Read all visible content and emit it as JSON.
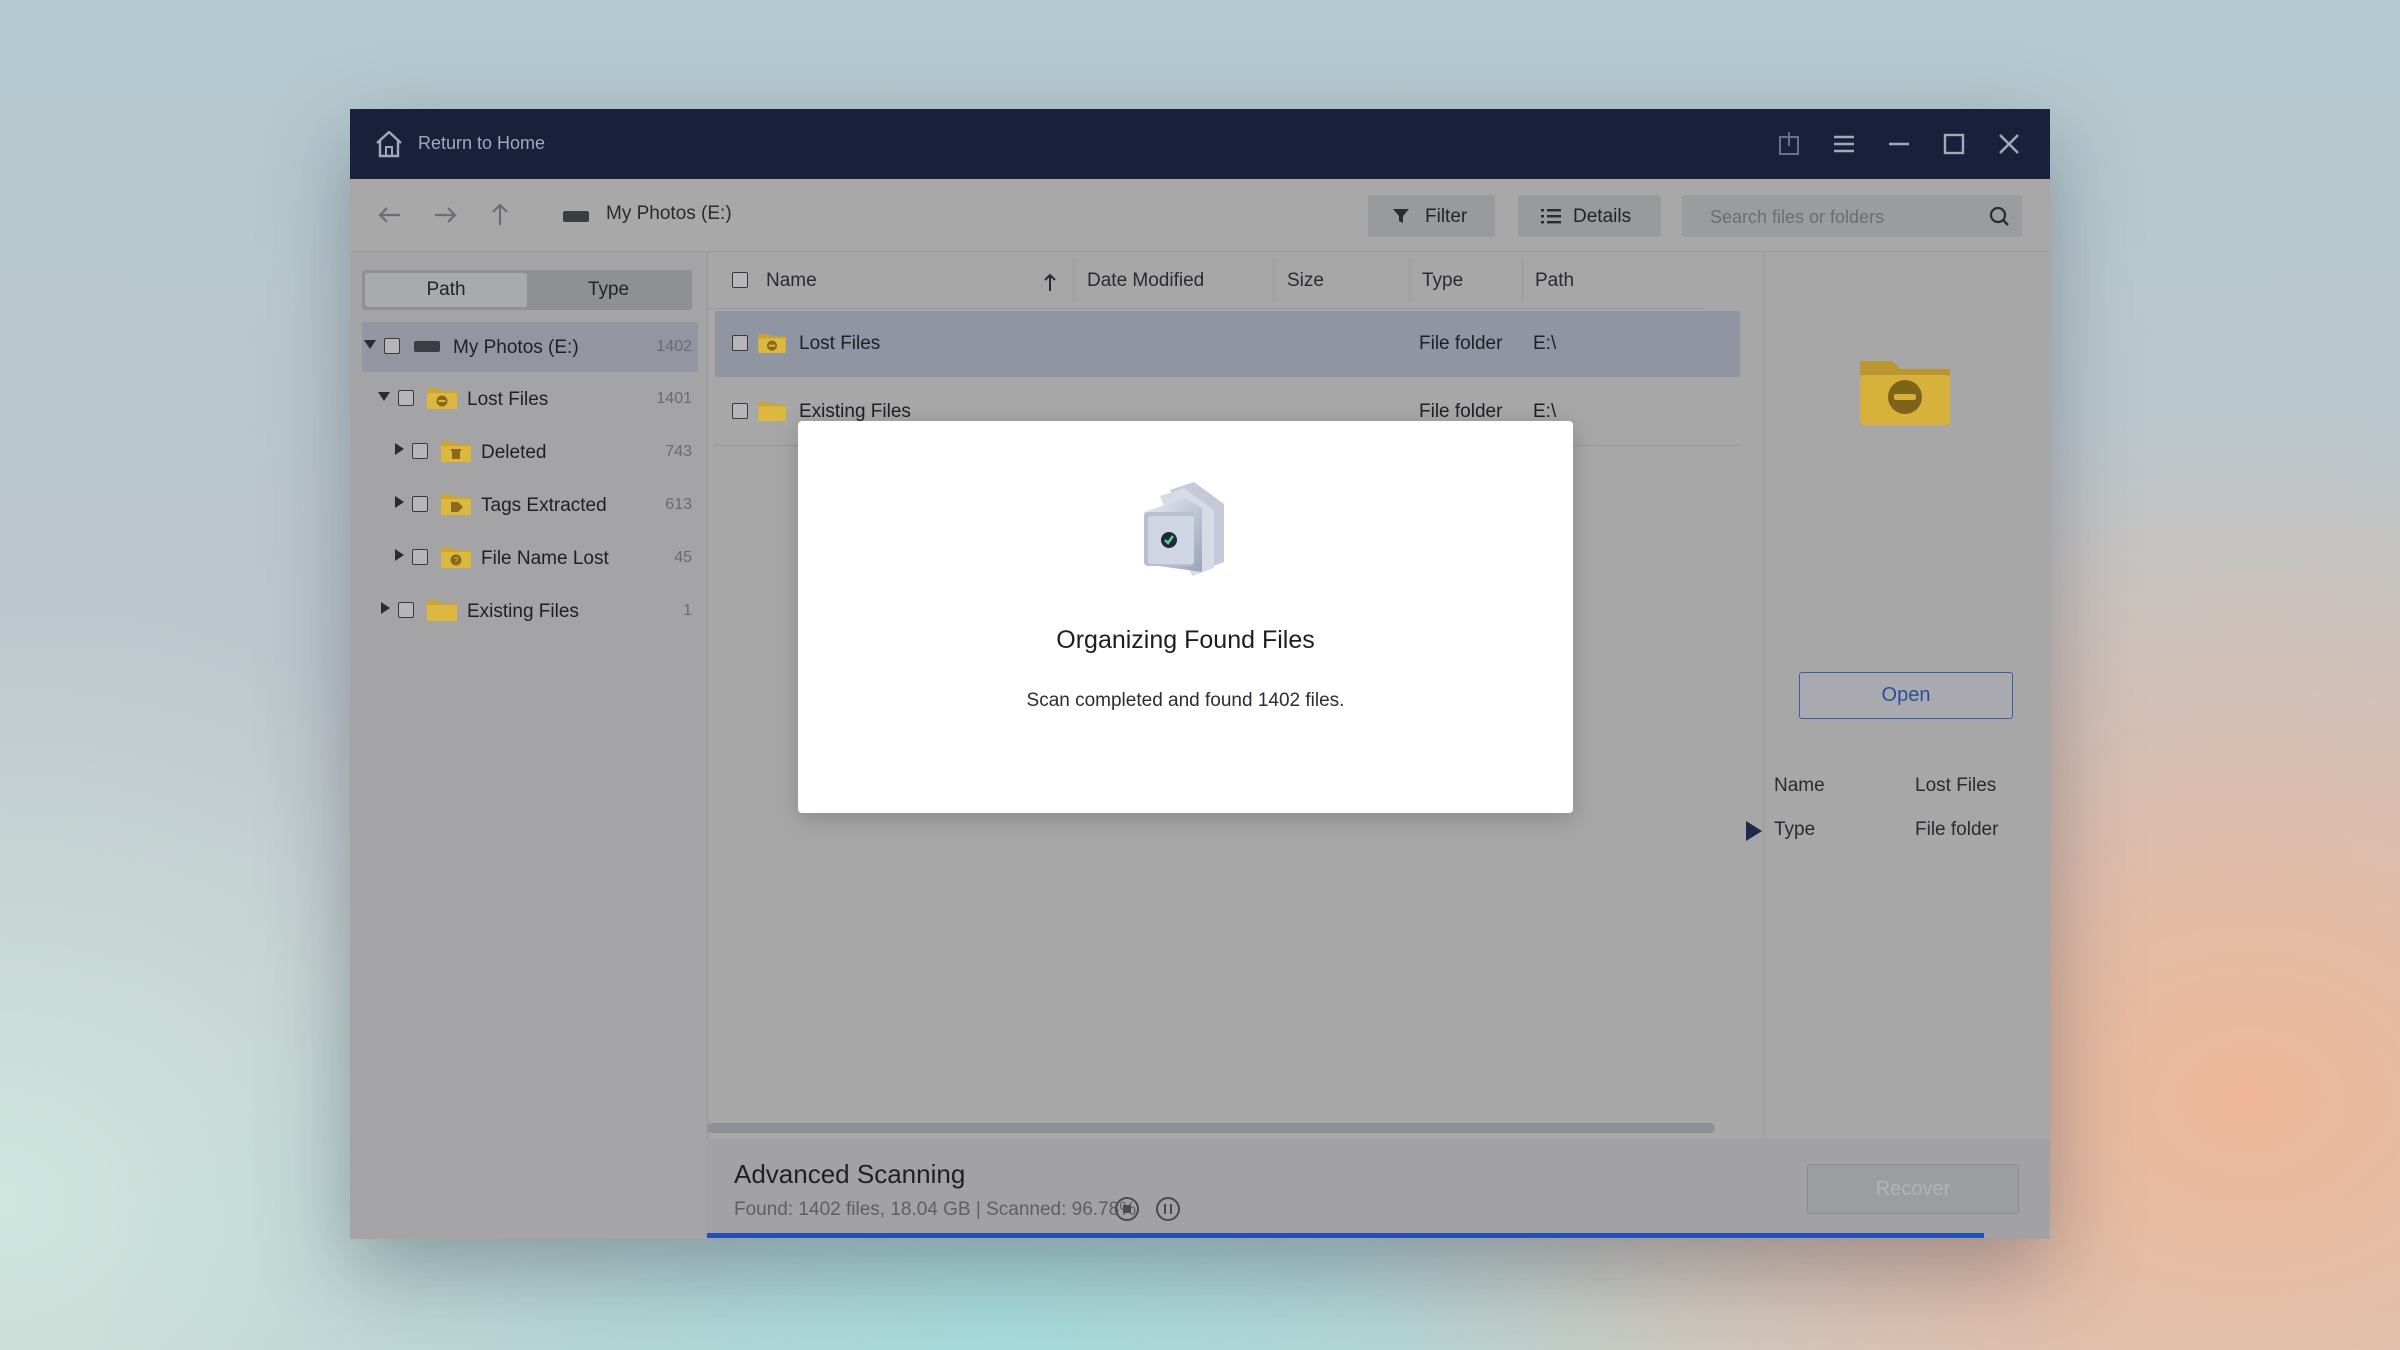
{
  "titlebar": {
    "home_label": "Return to Home"
  },
  "toolbar": {
    "breadcrumb": "My Photos (E:)",
    "filter_label": "Filter",
    "details_label": "Details",
    "search_placeholder": "Search files or folders"
  },
  "sidebar": {
    "tabs": [
      {
        "label": "Path",
        "active": true
      },
      {
        "label": "Type",
        "active": false
      }
    ],
    "tree": [
      {
        "label": "My Photos (E:)",
        "count": "1402",
        "expanded": true,
        "level": 0,
        "icon": "drive-icon",
        "selected": true
      },
      {
        "label": "Lost Files",
        "count": "1401",
        "expanded": true,
        "level": 1,
        "icon": "lost-files-folder-icon"
      },
      {
        "label": "Deleted",
        "count": "743",
        "expanded": false,
        "level": 2,
        "icon": "deleted-folder-icon"
      },
      {
        "label": "Tags Extracted",
        "count": "613",
        "expanded": false,
        "level": 2,
        "icon": "tags-folder-icon"
      },
      {
        "label": "File Name Lost",
        "count": "45",
        "expanded": false,
        "level": 2,
        "icon": "file-name-lost-folder-icon"
      },
      {
        "label": "Existing Files",
        "count": "1",
        "expanded": false,
        "level": 1,
        "icon": "folder-icon"
      }
    ]
  },
  "file_list": {
    "columns": [
      "Name",
      "Date Modified",
      "Size",
      "Type",
      "Path"
    ],
    "sort_column": "Name",
    "rows": [
      {
        "name": "Lost Files",
        "date_modified": "",
        "size": "",
        "type": "File folder",
        "path": "E:\\",
        "selected": true
      },
      {
        "name": "Existing Files",
        "date_modified": "",
        "size": "",
        "type": "File folder",
        "path": "E:\\",
        "selected": false
      }
    ]
  },
  "details_panel": {
    "open_label": "Open",
    "properties": [
      {
        "key": "Name",
        "value": "Lost Files"
      },
      {
        "key": "Type",
        "value": "File folder"
      }
    ]
  },
  "status": {
    "title": "Advanced Scanning",
    "info": "Found: 1402 files, 18.04 GB  |  Scanned: 96.78%",
    "scan_progress_percent": 96.78,
    "recover_label": "Recover"
  },
  "modal": {
    "title": "Organizing Found Files",
    "message": "Scan completed and found 1402 files."
  },
  "colors": {
    "titlebar": "#1a1f3c",
    "accent": "#2450b5",
    "folder": "#e2b93b"
  }
}
